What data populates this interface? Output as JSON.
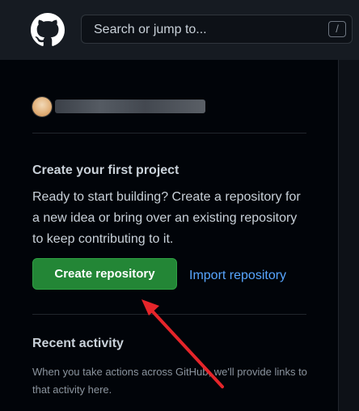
{
  "header": {
    "search_placeholder": "Search or jump to...",
    "search_shortcut": "/"
  },
  "sidebar": {
    "first_project": {
      "title": "Create your first project",
      "description": "Ready to start building? Create a repository for a new idea or bring over an existing repository to keep contributing to it.",
      "create_button_label": "Create repository",
      "import_link_label": "Import repository"
    },
    "recent_activity": {
      "title": "Recent activity",
      "description": "When you take actions across GitHub, we'll provide links to that activity here."
    }
  },
  "colors": {
    "header_bg": "#161b22",
    "page_bg": "#010409",
    "primary_button": "#238636",
    "link": "#58a6ff",
    "annotation_arrow": "#e5252a"
  },
  "icons": {
    "logo": "github-logo-icon",
    "annotation": "red-arrow-annotation"
  }
}
